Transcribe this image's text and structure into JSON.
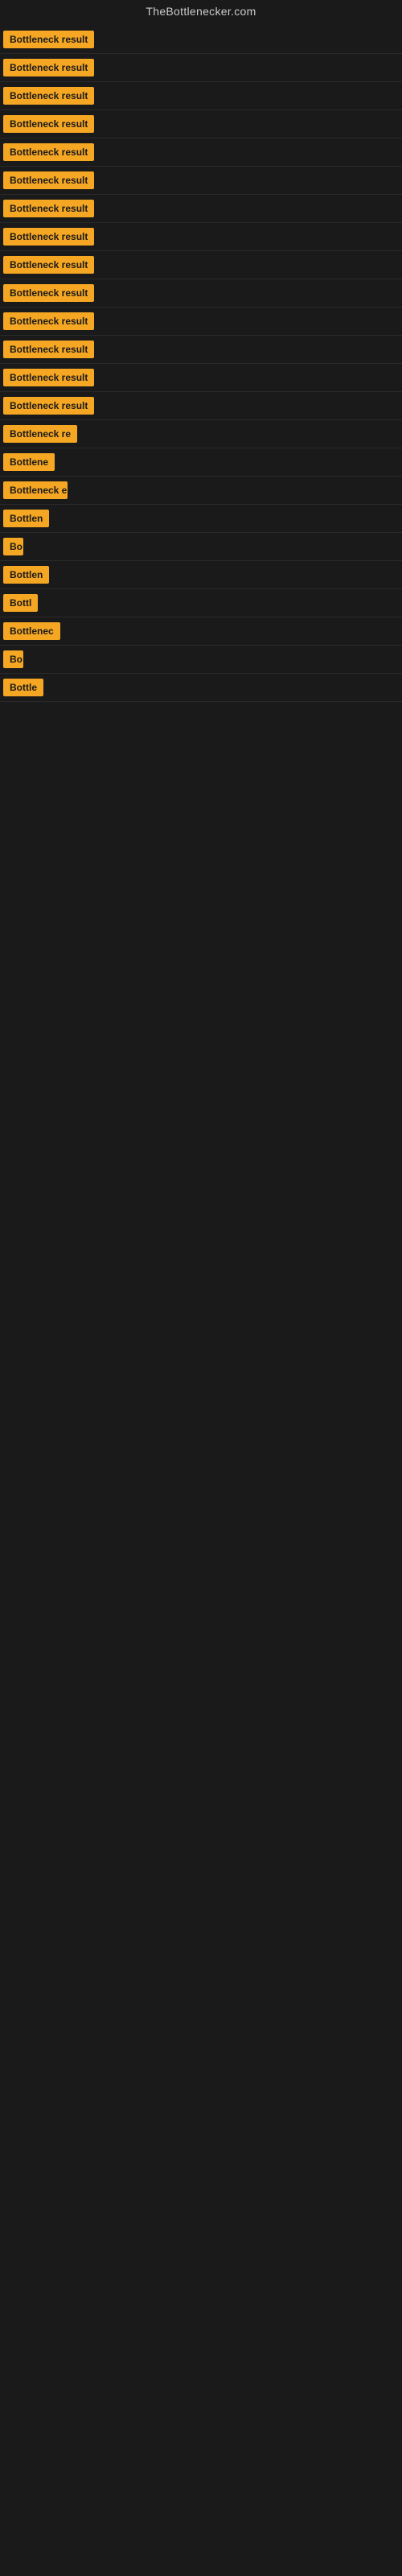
{
  "site": {
    "title": "TheBottlenecker.com"
  },
  "rows": [
    {
      "label": "Bottleneck result",
      "width": 120
    },
    {
      "label": "Bottleneck result",
      "width": 120
    },
    {
      "label": "Bottleneck result",
      "width": 120
    },
    {
      "label": "Bottleneck result",
      "width": 120
    },
    {
      "label": "Bottleneck result",
      "width": 120
    },
    {
      "label": "Bottleneck result",
      "width": 120
    },
    {
      "label": "Bottleneck result",
      "width": 120
    },
    {
      "label": "Bottleneck result",
      "width": 120
    },
    {
      "label": "Bottleneck result",
      "width": 120
    },
    {
      "label": "Bottleneck result",
      "width": 120
    },
    {
      "label": "Bottleneck result",
      "width": 120
    },
    {
      "label": "Bottleneck result",
      "width": 120
    },
    {
      "label": "Bottleneck result",
      "width": 120
    },
    {
      "label": "Bottleneck result",
      "width": 120
    },
    {
      "label": "Bottleneck re",
      "width": 95
    },
    {
      "label": "Bottlene",
      "width": 70
    },
    {
      "label": "Bottleneck e",
      "width": 80
    },
    {
      "label": "Bottlen",
      "width": 60
    },
    {
      "label": "Bo",
      "width": 25
    },
    {
      "label": "Bottlen",
      "width": 60
    },
    {
      "label": "Bottl",
      "width": 48
    },
    {
      "label": "Bottlenec",
      "width": 75
    },
    {
      "label": "Bo",
      "width": 25
    },
    {
      "label": "Bottle",
      "width": 52
    }
  ]
}
